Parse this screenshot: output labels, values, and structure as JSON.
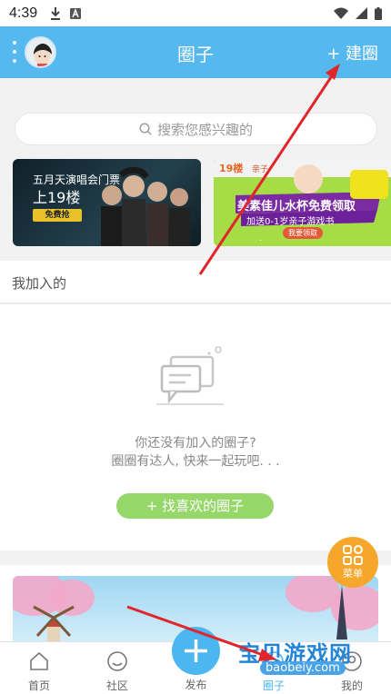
{
  "status_bar": {
    "time": "4:39"
  },
  "header": {
    "title": "圈子",
    "create_label": "+ 建圈"
  },
  "search": {
    "placeholder": "搜索您感兴趣的"
  },
  "banners": {
    "left": {
      "line1": "五月天演唱会门票",
      "line2": "上19楼",
      "cta": "免费抢"
    },
    "right": {
      "headline": "美素佳儿水杯免费领取",
      "sub": "加送0-1岁亲子游戏书",
      "cta": "我要领取"
    }
  },
  "joined": {
    "label": "我加入的",
    "empty_line1": "你还没有加入的圈子?",
    "empty_line2": "圈圈有达人, 快来一起玩吧. . .",
    "find_button": "+ 找喜欢的圈子"
  },
  "menu_fab": {
    "label": "菜单"
  },
  "tabs": [
    {
      "label": "首页",
      "icon": "home-icon"
    },
    {
      "label": "社区",
      "icon": "chat-icon"
    },
    {
      "label": "发布",
      "icon": "plus-icon"
    },
    {
      "label": "圈子",
      "icon": "circle-icon"
    },
    {
      "label": "我的",
      "icon": "user-icon"
    }
  ],
  "watermark": {
    "title": "宝贝游戏网",
    "url": "baobeiy.com"
  },
  "colors": {
    "header": "#55b8ee",
    "find_button": "#95d769",
    "menu_fab": "#f6a72b",
    "publish": "#4bb6ef",
    "arrow": "#e0252b"
  }
}
